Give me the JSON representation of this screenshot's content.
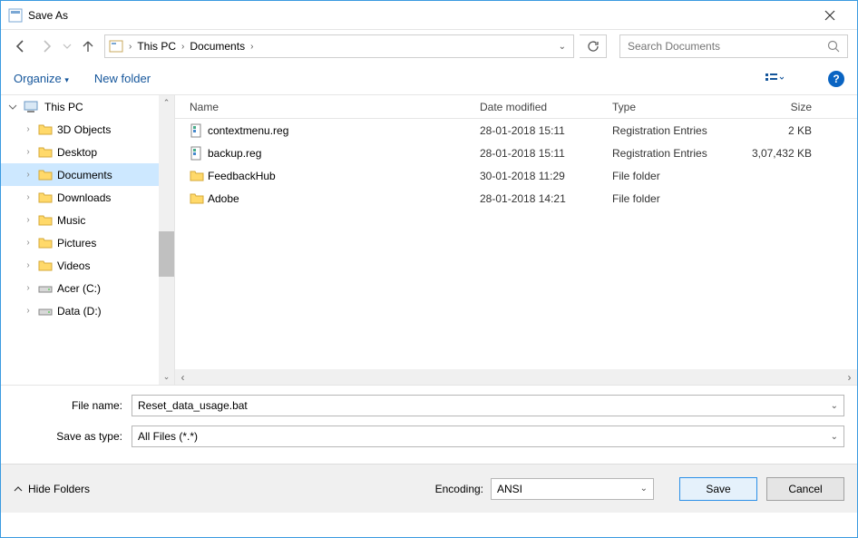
{
  "window": {
    "title": "Save As"
  },
  "breadcrumb": {
    "items": [
      "This PC",
      "Documents"
    ]
  },
  "search": {
    "placeholder": "Search Documents"
  },
  "toolbar": {
    "organize": "Organize",
    "new_folder": "New folder"
  },
  "tree": {
    "root": "This PC",
    "items": [
      {
        "label": "3D Objects"
      },
      {
        "label": "Desktop"
      },
      {
        "label": "Documents",
        "selected": true
      },
      {
        "label": "Downloads"
      },
      {
        "label": "Music"
      },
      {
        "label": "Pictures"
      },
      {
        "label": "Videos"
      },
      {
        "label": "Acer (C:)"
      },
      {
        "label": "Data (D:)"
      }
    ]
  },
  "columns": {
    "name": "Name",
    "date": "Date modified",
    "type": "Type",
    "size": "Size"
  },
  "files": [
    {
      "name": "contextmenu.reg",
      "date": "28-01-2018 15:11",
      "type": "Registration Entries",
      "size": "2 KB",
      "kind": "reg"
    },
    {
      "name": "backup.reg",
      "date": "28-01-2018 15:11",
      "type": "Registration Entries",
      "size": "3,07,432 KB",
      "kind": "reg"
    },
    {
      "name": "FeedbackHub",
      "date": "30-01-2018 11:29",
      "type": "File folder",
      "size": "",
      "kind": "folder"
    },
    {
      "name": "Adobe",
      "date": "28-01-2018 14:21",
      "type": "File folder",
      "size": "",
      "kind": "folder"
    }
  ],
  "form": {
    "filename_label": "File name:",
    "filename_value": "Reset_data_usage.bat",
    "type_label": "Save as type:",
    "type_value": "All Files  (*.*)"
  },
  "footer": {
    "hide_folders": "Hide Folders",
    "encoding_label": "Encoding:",
    "encoding_value": "ANSI",
    "save": "Save",
    "cancel": "Cancel"
  }
}
